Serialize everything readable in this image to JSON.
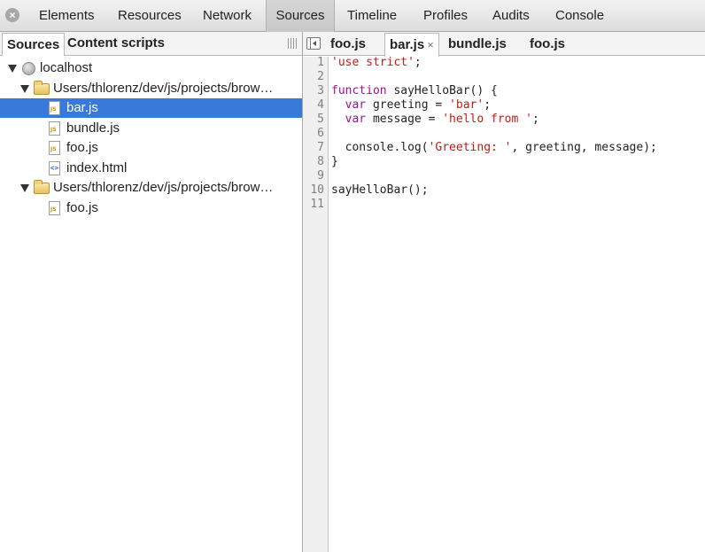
{
  "toolbar": {
    "tabs": [
      "Elements",
      "Resources",
      "Network",
      "Sources",
      "Timeline",
      "Profiles",
      "Audits",
      "Console"
    ],
    "active_tab": "Sources"
  },
  "navigator": {
    "tabs": [
      "Sources",
      "Content scripts"
    ],
    "active_tab": "Sources",
    "tree": [
      {
        "label": "localhost",
        "type": "domain"
      },
      {
        "label": "Users/thlorenz/dev/js/projects/brow…",
        "type": "folder"
      },
      {
        "label": "bar.js",
        "type": "js",
        "selected": true
      },
      {
        "label": "bundle.js",
        "type": "js"
      },
      {
        "label": "foo.js",
        "type": "js"
      },
      {
        "label": "index.html",
        "type": "html"
      },
      {
        "label": "Users/thlorenz/dev/js/projects/brow…",
        "type": "folder"
      },
      {
        "label": "foo.js",
        "type": "js"
      }
    ]
  },
  "editor": {
    "tabs": [
      {
        "label": "foo.js",
        "active": false
      },
      {
        "label": "bar.js",
        "active": true,
        "closable": true
      },
      {
        "label": "bundle.js",
        "active": false
      },
      {
        "label": "foo.js",
        "active": false
      }
    ],
    "close_glyph": "×",
    "line_numbers": [
      "1",
      "2",
      "3",
      "4",
      "5",
      "6",
      "7",
      "8",
      "9",
      "10",
      "11"
    ],
    "code_lines": [
      [
        {
          "t": "'use strict'",
          "c": "str"
        },
        {
          "t": ";",
          "c": ""
        }
      ],
      [],
      [
        {
          "t": "function",
          "c": "kw"
        },
        {
          "t": " sayHelloBar() {",
          "c": ""
        }
      ],
      [
        {
          "t": "  ",
          "c": ""
        },
        {
          "t": "var",
          "c": "kw"
        },
        {
          "t": " greeting = ",
          "c": ""
        },
        {
          "t": "'bar'",
          "c": "str"
        },
        {
          "t": ";",
          "c": ""
        }
      ],
      [
        {
          "t": "  ",
          "c": ""
        },
        {
          "t": "var",
          "c": "kw"
        },
        {
          "t": " message = ",
          "c": ""
        },
        {
          "t": "'hello from '",
          "c": "str"
        },
        {
          "t": ";",
          "c": ""
        }
      ],
      [],
      [
        {
          "t": "  console.log(",
          "c": ""
        },
        {
          "t": "'Greeting: '",
          "c": "str"
        },
        {
          "t": ", greeting, message);",
          "c": ""
        }
      ],
      [
        {
          "t": "}",
          "c": ""
        }
      ],
      [],
      [
        {
          "t": "sayHelloBar();",
          "c": ""
        }
      ],
      []
    ]
  },
  "colors": {
    "selection": "#3879d9",
    "keyword": "#aa0d91",
    "string": "#c41a16"
  },
  "icons": {
    "close": "close-circle-icon",
    "pane_toggle": "show-navigator-icon",
    "grip": "drag-grip-icon"
  }
}
